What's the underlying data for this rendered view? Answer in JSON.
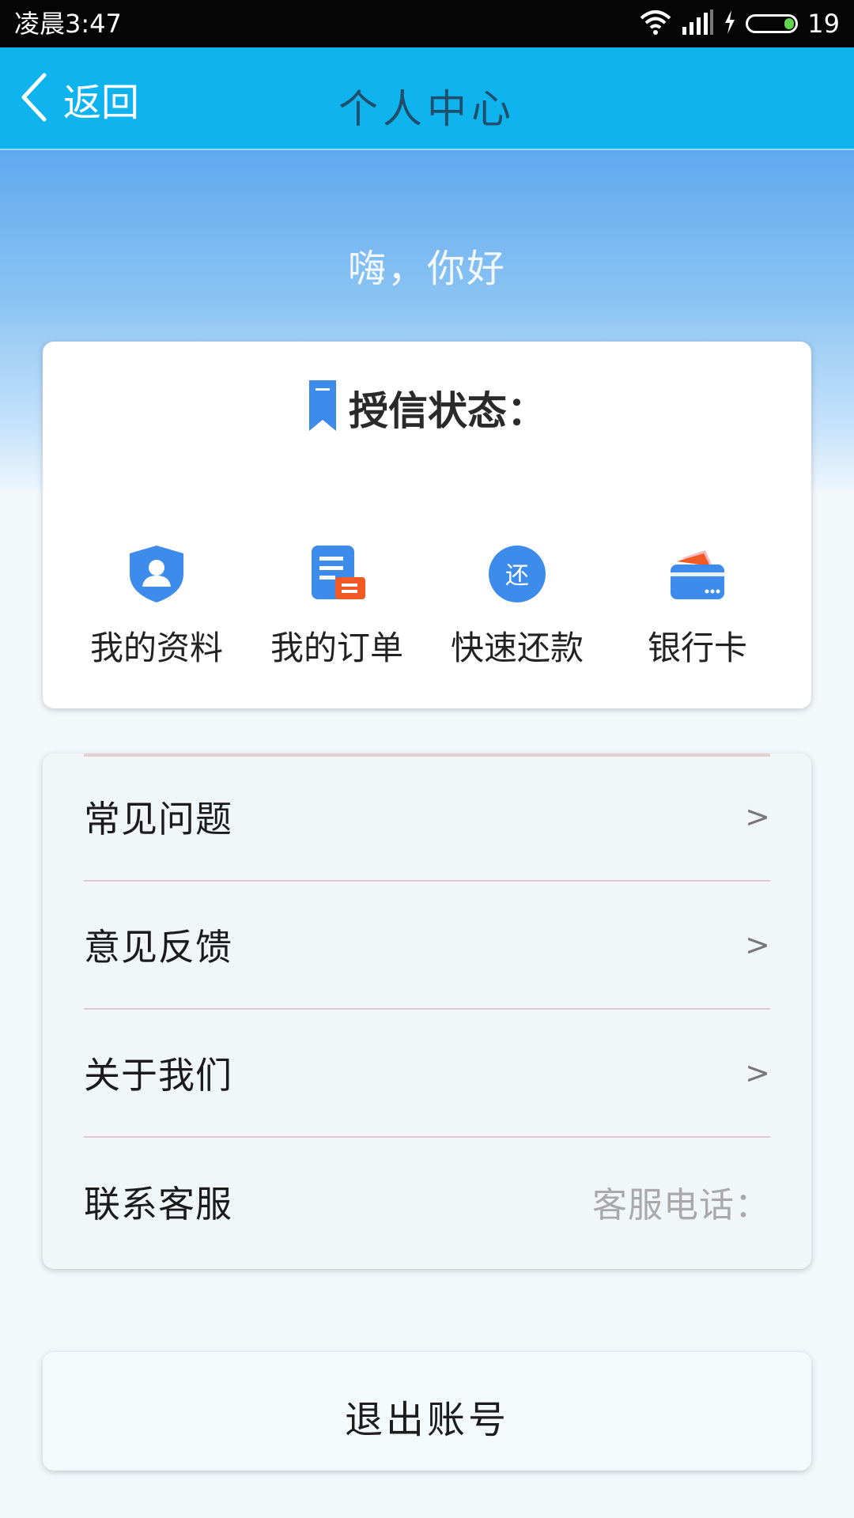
{
  "status_bar": {
    "time": "凌晨3:47",
    "battery_level": "19"
  },
  "app_bar": {
    "back_label": "返回",
    "title": "个人中心"
  },
  "greeting": "嗨，你好",
  "credit": {
    "label": "授信状态："
  },
  "quick_actions": [
    {
      "label": "我的资料",
      "icon": "profile-shield-icon"
    },
    {
      "label": "我的订单",
      "icon": "order-document-icon"
    },
    {
      "label": "快速还款",
      "icon": "repay-circle-icon",
      "icon_text": "还"
    },
    {
      "label": "银行卡",
      "icon": "bank-card-icon"
    }
  ],
  "menu": [
    {
      "label": "常见问题",
      "trailing": ">"
    },
    {
      "label": "意见反馈",
      "trailing": ">"
    },
    {
      "label": "关于我们",
      "trailing": ">"
    },
    {
      "label": "联系客服",
      "trailing": "客服电话："
    }
  ],
  "logout_label": "退出账号",
  "colors": {
    "app_bar": "#0fb4ef",
    "icon_blue": "#3d8bea",
    "icon_orange": "#f15a24",
    "battery_green": "#5fd34e"
  }
}
